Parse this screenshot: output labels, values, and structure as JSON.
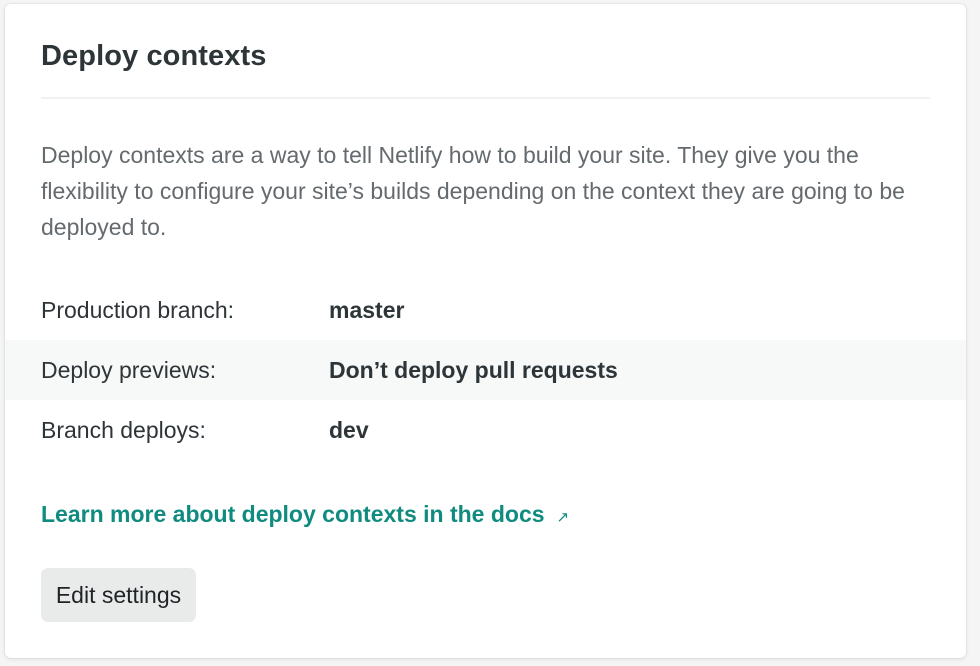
{
  "card": {
    "title": "Deploy contexts",
    "description": "Deploy contexts are a way to tell Netlify how to build your site. They give you the flexibility to configure your site’s builds depending on the context they are going to be deployed to.",
    "rows": [
      {
        "label": "Production branch:",
        "value": "master"
      },
      {
        "label": "Deploy previews:",
        "value": "Don’t deploy pull requests"
      },
      {
        "label": "Branch deploys:",
        "value": "dev"
      }
    ],
    "docs_link": {
      "text": "Learn more about deploy contexts in the docs",
      "icon": "external-link-icon",
      "icon_glyph": "↗"
    },
    "edit_button_label": "Edit settings"
  },
  "colors": {
    "link": "#0f8b7f",
    "text": "#2e3538",
    "muted_text": "#646a6e",
    "shaded_row": "#f7f8f8",
    "button_bg": "#e9ebeb"
  }
}
